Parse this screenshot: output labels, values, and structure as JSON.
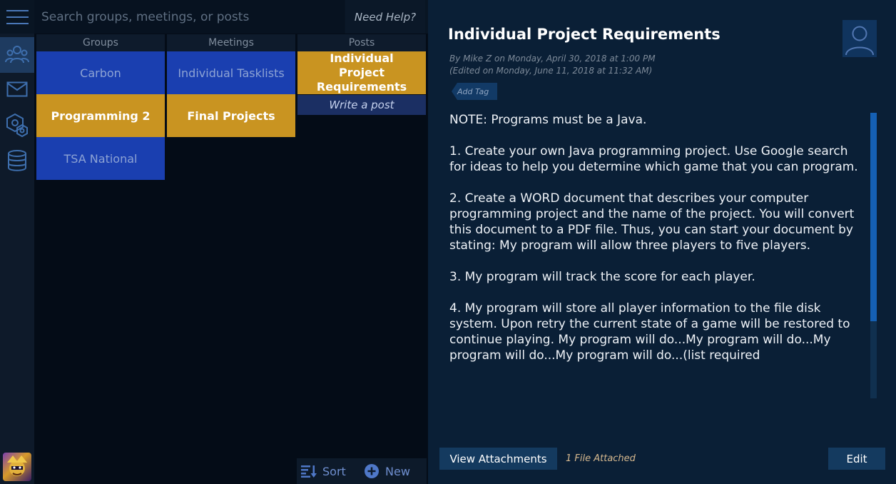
{
  "search": {
    "placeholder": "Search groups, meetings, or posts"
  },
  "header": {
    "help_label": "Need Help?"
  },
  "rail": {
    "items": [
      {
        "name": "groups-icon",
        "active": true
      },
      {
        "name": "mail-icon",
        "active": false
      },
      {
        "name": "hexagon-settings-icon",
        "active": false
      },
      {
        "name": "database-icon",
        "active": false
      }
    ]
  },
  "columns": {
    "groups": {
      "header": "Groups",
      "items": [
        {
          "label": "Carbon",
          "selected": false
        },
        {
          "label": "Programming 2",
          "selected": true
        },
        {
          "label": "TSA National",
          "selected": false
        }
      ]
    },
    "meetings": {
      "header": "Meetings",
      "items": [
        {
          "label": "Individual Tasklists",
          "selected": false
        },
        {
          "label": "Final Projects",
          "selected": true
        }
      ]
    },
    "posts": {
      "header": "Posts",
      "items": [
        {
          "label": "Individual Project Requirements",
          "selected": true
        }
      ],
      "write_label": "Write a post"
    }
  },
  "toolbar": {
    "sort_label": "Sort",
    "new_label": "New"
  },
  "post": {
    "title": "Individual Project Requirements",
    "byline": "By Mike Z on Monday, April 30, 2018 at 1:00 PM",
    "edited": "(Edited on Monday, June 11, 2018 at 11:32 AM)",
    "tag_label": "Add Tag",
    "paragraphs": [
      "NOTE: Programs must be a Java.",
      "1. Create your own Java programming project. Use Google search for ideas to help you determine which game that you can program.",
      "2. Create a WORD document that describes your computer programming project and the name of the project. You will convert this document to a PDF file. Thus, you can start your document by stating: My program will allow three players to five players.",
      "3. My program will track the score for each player.",
      "4. My program will store all player information to the file disk system. Upon retry the current state of a game will be restored to continue playing. My program will do...My program will do...My program will do...My program will do...(list required"
    ],
    "attachments_label": "View Attachments",
    "attachments_count": "1 File Attached",
    "edit_label": "Edit"
  },
  "colors": {
    "accent_blue": "#1a3fb0",
    "accent_gold": "#c99421",
    "panel_bg": "#0a1f36",
    "scroll_thumb": "#1560b4"
  }
}
